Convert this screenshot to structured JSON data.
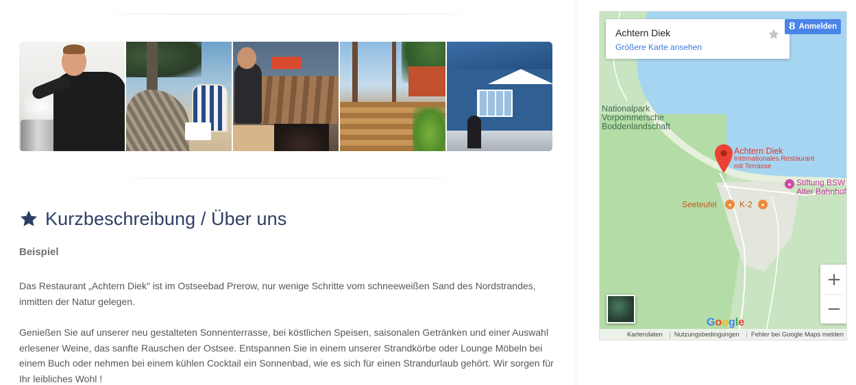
{
  "gallery": {
    "photos": [
      {
        "name": "chef-photo"
      },
      {
        "name": "beach-chair-photo"
      },
      {
        "name": "grill-photo"
      },
      {
        "name": "terrace-photo"
      },
      {
        "name": "building-photo"
      }
    ]
  },
  "about": {
    "title": "Kurzbeschreibung / Über uns",
    "icon": "star-icon",
    "subheading": "Beispiel",
    "paragraph1": "Das Restaurant „Achtern Diek\" ist im Ostseebad Prerow, nur wenige Schritte vom schneeweißen Sand des Nordstrandes, inmitten der Natur gelegen.",
    "paragraph2": "Genießen Sie auf unserer neu gestalteten Sonnenterrasse, bei köstlichen Speisen, saisonalen Getränken und einer Auswahl erlesener Weine, das sanfte Rauschen der Ostsee. Entspannen Sie in einem unserer Strandkörbe oder Lounge Möbeln bei einem Buch oder nehmen bei einem kühlen Cocktail ein Sonnenbad, wie es sich für einen Strandurlaub gehört. Wir sorgen für Ihr leibliches Wohl !"
  },
  "map": {
    "place_title": "Achtern Diek",
    "larger_map_link": "Größere Karte ansehen",
    "signin_label": "Anmelden",
    "signin_glyph": "8",
    "labels": {
      "national_park": "Nationalpark Vorpommersche Boddenlandschaft",
      "marker_name": "Achtern Diek",
      "marker_sub": "Internationales Restaurant mit Terrasse",
      "stiftung": "Stiftung BSW Alter Bahnhof",
      "seeteufel": "Seeteufel",
      "k2": "K-2"
    },
    "zoom_in": "+",
    "zoom_out": "−",
    "google": [
      "G",
      "o",
      "o",
      "g",
      "l",
      "e"
    ],
    "footer": {
      "map_data": "Kartendaten",
      "terms": "Nutzungsbedingungen",
      "report": "Fehler bei Google Maps melden"
    },
    "colors": {
      "water": "#a6d5f2",
      "land": "#c9e4c0",
      "forest": "#a8d49a",
      "town": "#e5e3df",
      "pin": "#ea4335"
    }
  },
  "colors": {
    "title": "#2c4063",
    "body_text": "#565656",
    "link": "#3b78d8",
    "signin": "#4a84e8"
  }
}
